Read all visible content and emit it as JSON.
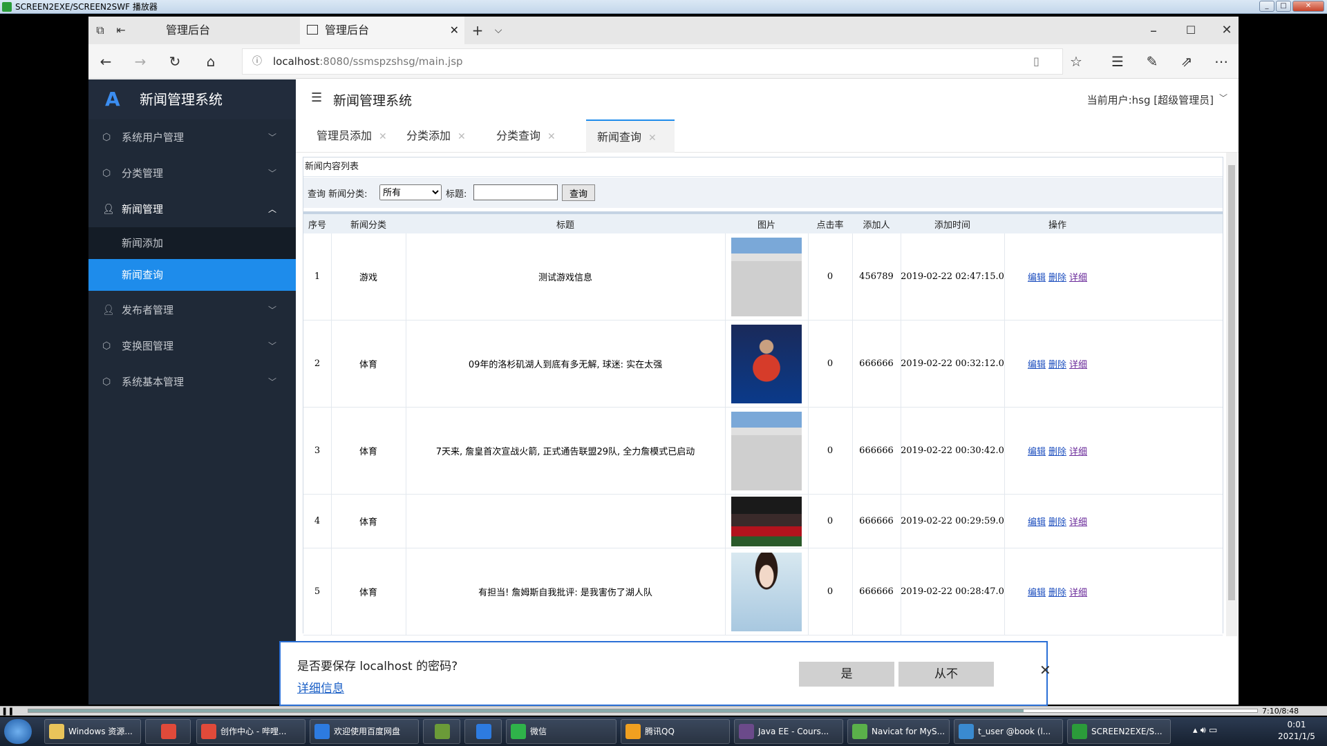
{
  "player": {
    "title": "SCREEN2EXE/SCREEN2SWF 播放器",
    "time": "7:10/8:48"
  },
  "browser": {
    "tabs": [
      {
        "label": "管理后台"
      },
      {
        "label": "管理后台"
      }
    ],
    "url_host": "localhost",
    "url_rest": ":8080/ssmspzshsg/main.jsp"
  },
  "app": {
    "brand": "新闻管理系统",
    "header_title": "新闻管理系统",
    "current_user": "当前用户:hsg [超级管理员]",
    "menu": [
      {
        "label": "系统用户管理",
        "icon": "cube-icon",
        "expanded": false
      },
      {
        "label": "分类管理",
        "icon": "cube-icon",
        "expanded": false
      },
      {
        "label": "新闻管理",
        "icon": "person-icon",
        "expanded": true,
        "children": [
          {
            "label": "新闻添加",
            "active": false
          },
          {
            "label": "新闻查询",
            "active": true
          }
        ]
      },
      {
        "label": "发布者管理",
        "icon": "person-icon",
        "expanded": false
      },
      {
        "label": "变换图管理",
        "icon": "cube-icon",
        "expanded": false
      },
      {
        "label": "系统基本管理",
        "icon": "cube-icon",
        "expanded": false
      }
    ],
    "page_tabs": [
      {
        "label": "管理员添加",
        "active": false
      },
      {
        "label": "分类添加",
        "active": false
      },
      {
        "label": "分类查询",
        "active": false
      },
      {
        "label": "新闻查询",
        "active": true
      }
    ]
  },
  "list": {
    "panel_title": "新闻内容列表",
    "filter_query_label": "查询 新闻分类:",
    "filter_category_value": "所有",
    "filter_title_label": "标题:",
    "filter_title_value": "",
    "filter_button": "查询",
    "columns": [
      "序号",
      "新闻分类",
      "标题",
      "图片",
      "点击率",
      "添加人",
      "添加时间",
      "操作"
    ],
    "rows": [
      {
        "no": "1",
        "category": "游戏",
        "title": "测试游戏信息",
        "image": "building",
        "clicks": "0",
        "adder": "456789",
        "time": "2019-02-22 02:47:15.0"
      },
      {
        "no": "2",
        "category": "体育",
        "title": "09年的洛杉矶湖人到底有多无解, 球迷: 实在太强",
        "image": "pingpong",
        "clicks": "0",
        "adder": "666666",
        "time": "2019-02-22 00:32:12.0"
      },
      {
        "no": "3",
        "category": "体育",
        "title": "7天来, 詹皇首次宣战火箭, 正式通告联盟29队, 全力詹模式已启动",
        "image": "building",
        "clicks": "0",
        "adder": "666666",
        "time": "2019-02-22 00:30:42.0"
      },
      {
        "no": "4",
        "category": "体育",
        "title": "",
        "image": "soccer",
        "clicks": "0",
        "adder": "666666",
        "time": "2019-02-22 00:29:59.0"
      },
      {
        "no": "5",
        "category": "体育",
        "title": "有担当! 詹姆斯自我批评: 是我害伤了湖人队",
        "image": "portrait",
        "clicks": "0",
        "adder": "666666",
        "time": "2019-02-22 00:28:47.0"
      }
    ],
    "ops": {
      "edit": "编辑",
      "delete": "删除",
      "detail": "详细"
    }
  },
  "password_bar": {
    "question": "是否要保存 localhost 的密码?",
    "more": "详细信息",
    "yes": "是",
    "never": "从不"
  },
  "taskbar": {
    "items": [
      {
        "label": "Windows 资源...",
        "color": "#e9c45a"
      },
      {
        "label": "",
        "color": "#e04a3a"
      },
      {
        "label": "创作中心 - 哔哩...",
        "color": "#e04a3a"
      },
      {
        "label": "欢迎使用百度网盘",
        "color": "#2d7be0"
      },
      {
        "label": "",
        "color": "#6b9b38"
      },
      {
        "label": "",
        "color": "#2d7be0"
      },
      {
        "label": "微信",
        "color": "#2fb34a"
      },
      {
        "label": "腾讯QQ",
        "color": "#f0a020"
      },
      {
        "label": "Java EE - Cours...",
        "color": "#6b4a8a"
      },
      {
        "label": "Navicat for MyS...",
        "color": "#5ab04a"
      },
      {
        "label": "t_user @book (l...",
        "color": "#3a8ad0"
      },
      {
        "label": "SCREEN2EXE/S...",
        "color": "#2b9b3a"
      }
    ],
    "clock_time": "0:01",
    "clock_date": "2021/1/5"
  }
}
